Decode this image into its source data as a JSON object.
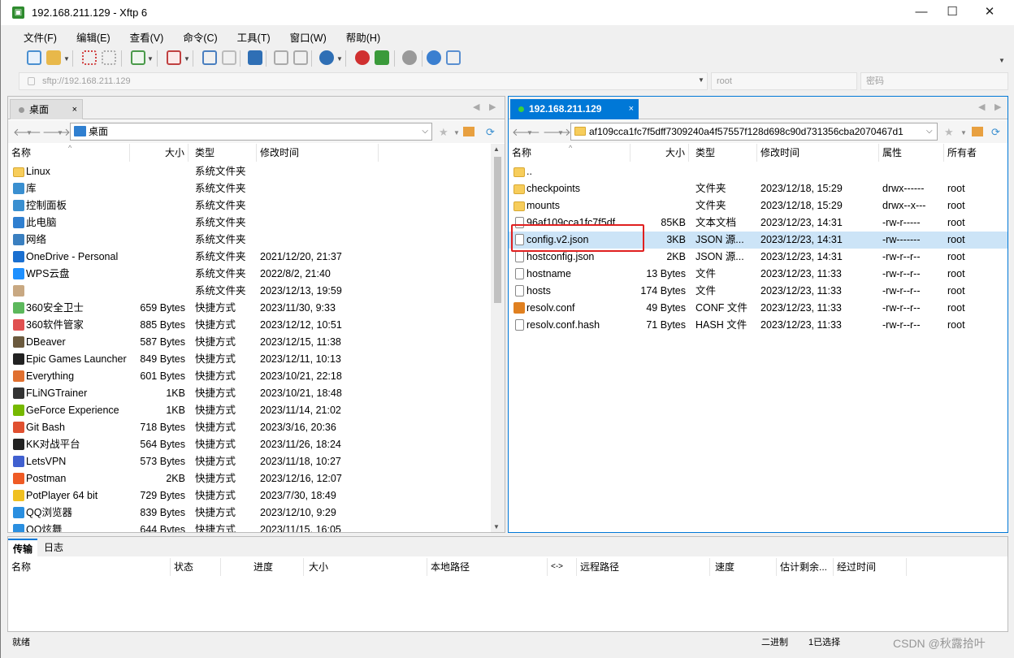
{
  "window": {
    "title": "192.168.211.129 - Xftp 6",
    "app_icon": "xftp-app-icon",
    "minimize": "—",
    "maximize": "☐",
    "close": "✕"
  },
  "menu": [
    "文件(F)",
    "编辑(E)",
    "查看(V)",
    "命令(C)",
    "工具(T)",
    "窗口(W)",
    "帮助(H)"
  ],
  "address": {
    "url": "sftp://192.168.211.129",
    "user_placeholder": "root",
    "password_placeholder": "密码"
  },
  "left_pane": {
    "tab_label": "桌面",
    "tab_close": "×",
    "path": "桌面",
    "columns": [
      "名称",
      "大小",
      "类型",
      "修改时间"
    ],
    "rows": [
      {
        "name": "Linux",
        "size": "",
        "type": "系统文件夹",
        "modified": "",
        "icon": "folder-icon"
      },
      {
        "name": "库",
        "size": "",
        "type": "系统文件夹",
        "modified": "",
        "icon": "library-icon"
      },
      {
        "name": "控制面板",
        "size": "",
        "type": "系统文件夹",
        "modified": "",
        "icon": "control-panel-icon"
      },
      {
        "name": "此电脑",
        "size": "",
        "type": "系统文件夹",
        "modified": "",
        "icon": "computer-icon"
      },
      {
        "name": "网络",
        "size": "",
        "type": "系统文件夹",
        "modified": "",
        "icon": "network-icon"
      },
      {
        "name": "OneDrive - Personal",
        "size": "",
        "type": "系统文件夹",
        "modified": "2021/12/20, 21:37",
        "icon": "onedrive-icon"
      },
      {
        "name": "WPS云盘",
        "size": "",
        "type": "系统文件夹",
        "modified": "2022/8/2, 21:40",
        "icon": "wps-cloud-icon"
      },
      {
        "name": "",
        "size": "",
        "type": "系统文件夹",
        "modified": "2023/12/13, 19:59",
        "icon": "user-icon"
      },
      {
        "name": "360安全卫士",
        "size": "659 Bytes",
        "type": "快捷方式",
        "modified": "2023/11/30, 9:33",
        "icon": "360-icon"
      },
      {
        "name": "360软件管家",
        "size": "885 Bytes",
        "type": "快捷方式",
        "modified": "2023/12/12, 10:51",
        "icon": "360-software-icon"
      },
      {
        "name": "DBeaver",
        "size": "587 Bytes",
        "type": "快捷方式",
        "modified": "2023/12/15, 11:38",
        "icon": "dbeaver-icon"
      },
      {
        "name": "Epic Games Launcher",
        "size": "849 Bytes",
        "type": "快捷方式",
        "modified": "2023/12/11, 10:13",
        "icon": "epic-games-icon"
      },
      {
        "name": "Everything",
        "size": "601 Bytes",
        "type": "快捷方式",
        "modified": "2023/10/21, 22:18",
        "icon": "everything-icon"
      },
      {
        "name": "FLiNGTrainer",
        "size": "1KB",
        "type": "快捷方式",
        "modified": "2023/10/21, 18:48",
        "icon": "fling-trainer-icon"
      },
      {
        "name": "GeForce Experience",
        "size": "1KB",
        "type": "快捷方式",
        "modified": "2023/11/14, 21:02",
        "icon": "geforce-icon"
      },
      {
        "name": "Git Bash",
        "size": "718 Bytes",
        "type": "快捷方式",
        "modified": "2023/3/16, 20:36",
        "icon": "git-bash-icon"
      },
      {
        "name": "KK对战平台",
        "size": "564 Bytes",
        "type": "快捷方式",
        "modified": "2023/11/26, 18:24",
        "icon": "kk-platform-icon"
      },
      {
        "name": "LetsVPN",
        "size": "573 Bytes",
        "type": "快捷方式",
        "modified": "2023/11/18, 10:27",
        "icon": "letsvpn-icon"
      },
      {
        "name": "Postman",
        "size": "2KB",
        "type": "快捷方式",
        "modified": "2023/12/16, 12:07",
        "icon": "postman-icon"
      },
      {
        "name": "PotPlayer 64 bit",
        "size": "729 Bytes",
        "type": "快捷方式",
        "modified": "2023/7/30, 18:49",
        "icon": "potplayer-icon"
      },
      {
        "name": "QQ浏览器",
        "size": "839 Bytes",
        "type": "快捷方式",
        "modified": "2023/12/10, 9:29",
        "icon": "qq-browser-icon"
      },
      {
        "name": "QQ炫舞",
        "size": "644 Bytes",
        "type": "快捷方式",
        "modified": "2023/11/15, 16:05",
        "icon": "qq-dance-icon"
      }
    ]
  },
  "right_pane": {
    "tab_label": "192.168.211.129",
    "tab_close": "×",
    "path": "af109cca1fc7f5dff7309240a4f57557f128d698c90d731356cba2070467d1",
    "columns": [
      "名称",
      "大小",
      "类型",
      "修改时间",
      "属性",
      "所有者"
    ],
    "rows": [
      {
        "name": "..",
        "size": "",
        "type": "",
        "modified": "",
        "attr": "",
        "owner": "",
        "icon": "folder-icon"
      },
      {
        "name": "checkpoints",
        "size": "",
        "type": "文件夹",
        "modified": "2023/12/18, 15:29",
        "attr": "drwx------",
        "owner": "root",
        "icon": "folder-icon"
      },
      {
        "name": "mounts",
        "size": "",
        "type": "文件夹",
        "modified": "2023/12/18, 15:29",
        "attr": "drwx--x---",
        "owner": "root",
        "icon": "folder-icon"
      },
      {
        "name": "96af109cca1fc7f5df...",
        "size": "85KB",
        "type": "文本文档",
        "modified": "2023/12/23, 14:31",
        "attr": "-rw-r-----",
        "owner": "root",
        "icon": "text-file-icon"
      },
      {
        "name": "config.v2.json",
        "size": "3KB",
        "type": "JSON 源...",
        "modified": "2023/12/23, 14:31",
        "attr": "-rw-------",
        "owner": "root",
        "icon": "json-file-icon",
        "selected": true
      },
      {
        "name": "hostconfig.json",
        "size": "2KB",
        "type": "JSON 源...",
        "modified": "2023/12/23, 14:31",
        "attr": "-rw-r--r--",
        "owner": "root",
        "icon": "json-file-icon"
      },
      {
        "name": "hostname",
        "size": "13 Bytes",
        "type": "文件",
        "modified": "2023/12/23, 11:33",
        "attr": "-rw-r--r--",
        "owner": "root",
        "icon": "file-icon"
      },
      {
        "name": "hosts",
        "size": "174 Bytes",
        "type": "文件",
        "modified": "2023/12/23, 11:33",
        "attr": "-rw-r--r--",
        "owner": "root",
        "icon": "file-icon"
      },
      {
        "name": "resolv.conf",
        "size": "49 Bytes",
        "type": "CONF 文件",
        "modified": "2023/12/23, 11:33",
        "attr": "-rw-r--r--",
        "owner": "root",
        "icon": "conf-file-icon"
      },
      {
        "name": "resolv.conf.hash",
        "size": "71 Bytes",
        "type": "HASH 文件",
        "modified": "2023/12/23, 11:33",
        "attr": "-rw-r--r--",
        "owner": "root",
        "icon": "file-icon"
      }
    ]
  },
  "transfer": {
    "tabs": [
      "传输",
      "日志"
    ],
    "columns": [
      "名称",
      "状态",
      "进度",
      "大小",
      "本地路径",
      "<->",
      "远程路径",
      "速度",
      "估计剩余...",
      "经过时间"
    ]
  },
  "statusbar": {
    "left": "就绪",
    "mode": "二进制",
    "selection": "1已选择"
  },
  "watermark": "CSDN @秋露拾叶",
  "colors": {
    "selection": "#cce4f7",
    "active_tab": "#0078d7",
    "highlight_box": "#e02020",
    "folder": "#f7cd5b"
  }
}
